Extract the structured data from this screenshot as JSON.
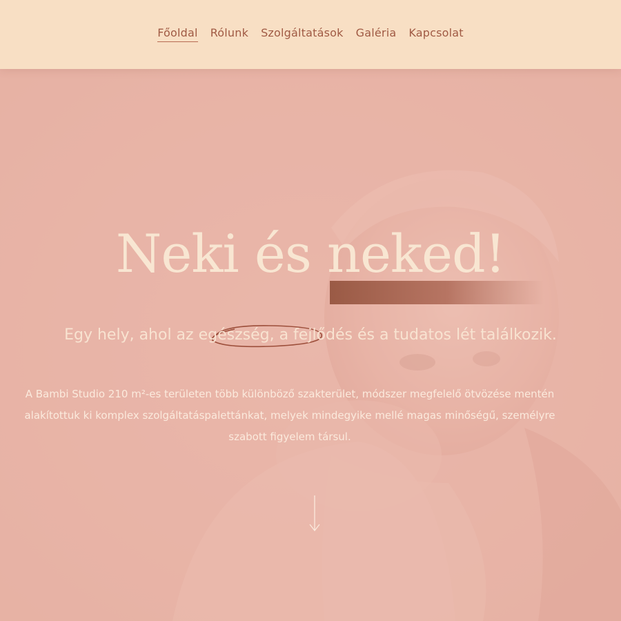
{
  "nav": {
    "items": [
      {
        "label": "Főoldal",
        "active": true
      },
      {
        "label": "Rólunk",
        "active": false
      },
      {
        "label": "Szolgáltatások",
        "active": false
      },
      {
        "label": "Galéria",
        "active": false
      },
      {
        "label": "Kapcsolat",
        "active": false
      }
    ]
  },
  "hero": {
    "headline": "Neki és neked!",
    "subtitle": "Egy hely, ahol az egészség, a fejlődés és a tudatos lét találkozik.",
    "subtitle_highlight": "egészség",
    "description": "A Bambi Studio 210 m²-es területen több különböző szakterület, módszer megfelelő ötvözése mentén alakítottuk ki komplex szolgáltatáspalettánkat, melyek mindegyike mellé magas minőségű, személyre szabott figyelem társul.",
    "scroll_icon": "arrow-down-icon"
  },
  "colors": {
    "header_bg": "#f8dfc4",
    "nav_text": "#a05a44",
    "hero_overlay": "#e9b9ac",
    "headline_text": "#f8e6d2",
    "accent_bar": "#9a5a45"
  }
}
